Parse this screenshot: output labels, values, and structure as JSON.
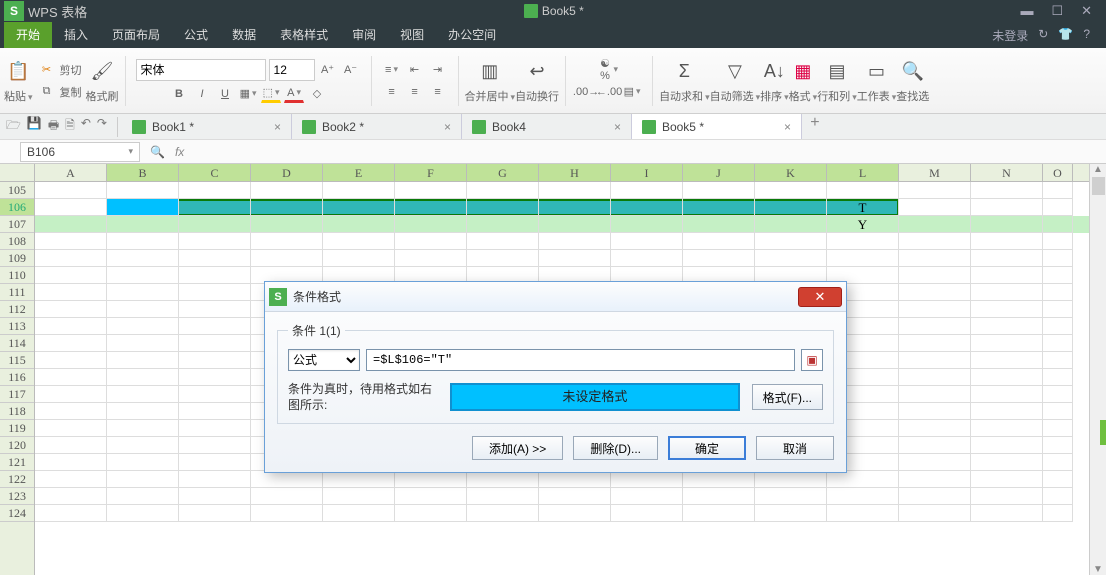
{
  "titlebar": {
    "app": "WPS 表格",
    "doc": "Book5 *"
  },
  "menu": {
    "items": [
      "开始",
      "插入",
      "页面布局",
      "公式",
      "数据",
      "表格样式",
      "审阅",
      "视图",
      "办公空间"
    ],
    "right_login": "未登录"
  },
  "ribbon": {
    "paste": "粘贴",
    "cut": "剪切",
    "copy": "复制",
    "brush": "格式刷",
    "font_name": "宋体",
    "font_size": "12",
    "merge": "合并居中",
    "wrap": "自动换行",
    "autosum": "自动求和",
    "autofilter": "自动筛选",
    "sort": "排序",
    "format": "格式",
    "rowcol": "行和列",
    "sheet": "工作表",
    "find": "查找选"
  },
  "tabs": {
    "items": [
      {
        "label": "Book1 *",
        "active": false
      },
      {
        "label": "Book2 *",
        "active": false
      },
      {
        "label": "Book4",
        "active": false
      },
      {
        "label": "Book5 *",
        "active": true
      }
    ]
  },
  "namebox": "B106",
  "columns": [
    "A",
    "B",
    "C",
    "D",
    "E",
    "F",
    "G",
    "H",
    "I",
    "J",
    "K",
    "L",
    "M",
    "N",
    "O"
  ],
  "rows": [
    "105",
    "106",
    "107",
    "108",
    "109",
    "110",
    "111",
    "112",
    "113",
    "114",
    "115",
    "116",
    "117",
    "118",
    "119",
    "120",
    "121",
    "122",
    "123",
    "124"
  ],
  "cells": {
    "L106": "T",
    "L107": "Y"
  },
  "dialog": {
    "title": "条件格式",
    "legend": "条件 1(1)",
    "type_option": "公式",
    "formula": "=$L$106=\"T\"",
    "hint": "条件为真时，待用格式如右图所示:",
    "preview": "未设定格式",
    "format_btn": "格式(F)...",
    "add": "添加(A) >>",
    "delete": "删除(D)...",
    "ok": "确定",
    "cancel": "取消"
  }
}
